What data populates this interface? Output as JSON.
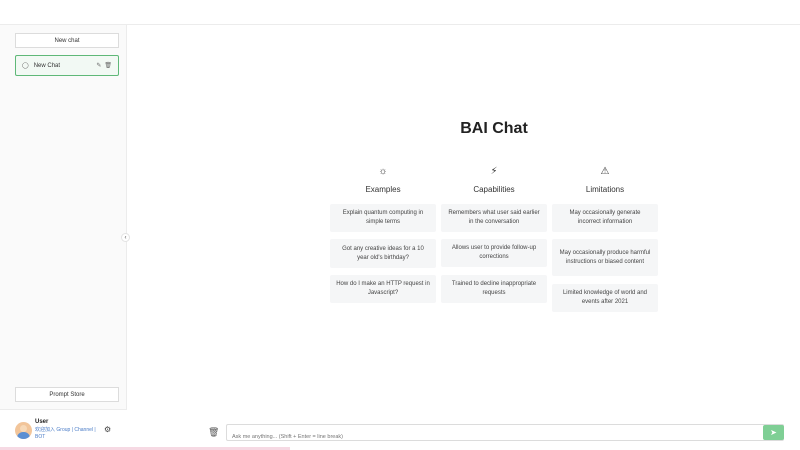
{
  "sidebar": {
    "new_chat_label": "New chat",
    "chats": [
      {
        "label": "New Chat"
      }
    ],
    "prompt_store_label": "Prompt Store",
    "user": {
      "name": "User",
      "subtitle": "欢迎加入 Group | Channel | BOT"
    }
  },
  "main": {
    "title": "BAI Chat",
    "columns": [
      {
        "title": "Examples",
        "icon": "sun-icon",
        "cards": [
          "Explain quantum computing in simple terms",
          "Got any creative ideas for a 10 year old's birthday?",
          "How do I make an HTTP request in Javascript?"
        ]
      },
      {
        "title": "Capabilities",
        "icon": "lightning-icon",
        "cards": [
          "Remembers what user said earlier in the conversation",
          "Allows user to provide follow-up corrections",
          "Trained to decline inappropriate requests"
        ]
      },
      {
        "title": "Limitations",
        "icon": "warning-icon",
        "cards": [
          "May occasionally generate incorrect information",
          "May occasionally produce harmful instructions or biased content",
          "Limited knowledge of world and events after 2021"
        ]
      }
    ]
  },
  "input": {
    "placeholder": "Ask me anything... (Shift + Enter = line break)"
  },
  "colors": {
    "accent": "#5fb878",
    "send": "#7fcf95",
    "card_bg": "#f5f6f7",
    "link": "#4a7cc7"
  }
}
